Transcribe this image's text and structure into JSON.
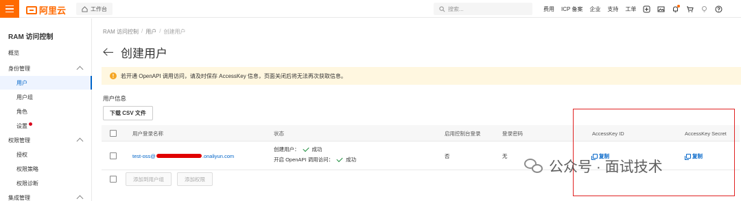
{
  "topbar": {
    "brand": "阿里云",
    "workbench": "工作台",
    "search_placeholder": "搜索...",
    "nav": [
      "费用",
      "ICP 备案",
      "企业",
      "支持",
      "工单"
    ]
  },
  "sidebar": {
    "title": "RAM 访问控制",
    "items": [
      {
        "label": "概览"
      },
      {
        "label": "身份管理"
      },
      {
        "label": "用户"
      },
      {
        "label": "用户组"
      },
      {
        "label": "角色"
      },
      {
        "label": "设置"
      },
      {
        "label": "权限管理"
      },
      {
        "label": "授权"
      },
      {
        "label": "权限策略"
      },
      {
        "label": "权限诊断"
      },
      {
        "label": "集成管理"
      }
    ]
  },
  "breadcrumb": [
    "RAM 访问控制",
    "用户",
    "创建用户"
  ],
  "page": {
    "title": "创建用户",
    "alert": "若开通 OpenAPI 调用访问，请及时保存 AccessKey 信息，页面关闭后将无法再次获取信息。",
    "section_label": "用户信息",
    "download_csv": "下载 CSV 文件"
  },
  "table": {
    "headers": [
      "用户登录名称",
      "状态",
      "启用控制台登录",
      "登录密码",
      "AccessKey ID",
      "AccessKey Secret"
    ],
    "rows": [
      {
        "login_prefix": "test-oss@",
        "login_suffix": ".onaliyun.com",
        "status_create": "创建用户：",
        "status_create_result": "成功",
        "status_openapi": "开启 OpenAPI 调用访问：",
        "status_openapi_result": "成功",
        "console_login": "否",
        "password": "无",
        "access_key_id_action": "复制",
        "access_key_secret_action": "复制"
      }
    ],
    "footer_buttons": [
      "添加到用户组",
      "添加权限"
    ]
  },
  "watermark": "公众号 · 面试技术",
  "colors": {
    "brand": "#ff6a00",
    "link": "#0064c8",
    "success": "#1e8e3e",
    "warning_bg": "#fff7e0",
    "annotation": "#e02020"
  }
}
